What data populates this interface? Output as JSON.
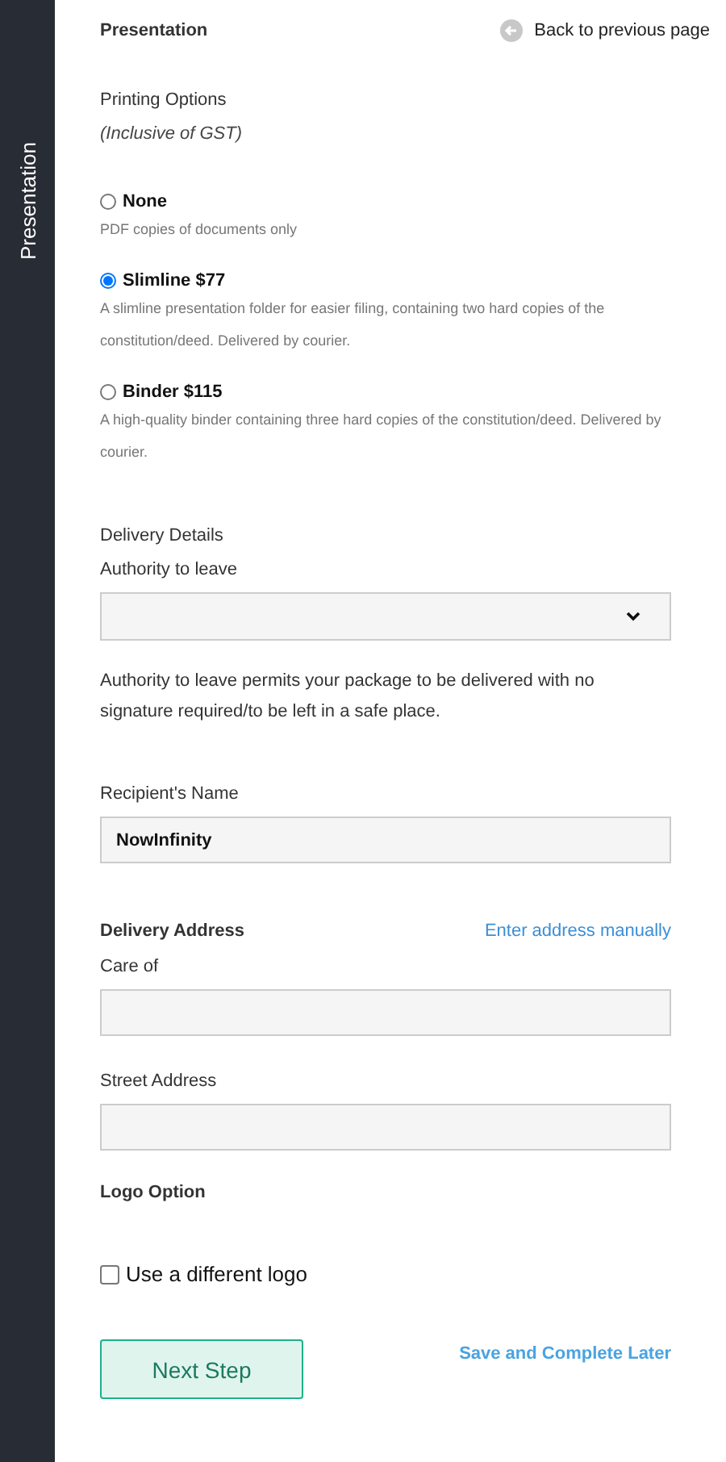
{
  "sidebar": {
    "label": "Presentation"
  },
  "header": {
    "title": "Presentation",
    "back_link": "Back to previous page"
  },
  "printing": {
    "heading": "Printing Options",
    "note": "(Inclusive of GST)",
    "options": [
      {
        "label": "None",
        "selected": false,
        "description": "PDF copies of documents only"
      },
      {
        "label": "Slimline $77",
        "selected": true,
        "description": "A slimline presentation folder for easier filing, containing two hard copies of the constitution/deed. Delivered by courier."
      },
      {
        "label": "Binder $115",
        "selected": false,
        "description": "A high-quality binder containing three hard copies of the constitution/deed. Delivered by courier."
      }
    ]
  },
  "delivery": {
    "heading": "Delivery Details",
    "authority_label": "Authority to leave",
    "authority_note": "Authority to leave permits your package to be delivered with no signature required/to be left in a safe place.",
    "recipient_label": "Recipient's Name",
    "recipient_value": "NowInfinity"
  },
  "address": {
    "heading": "Delivery Address",
    "manual_link": "Enter address manually",
    "care_of_label": "Care of",
    "street_label": "Street Address"
  },
  "logo": {
    "heading": "Logo Option",
    "checkbox_label": "Use a different logo",
    "checked": false
  },
  "actions": {
    "next": "Next Step",
    "save_later": "Save and Complete Later"
  }
}
